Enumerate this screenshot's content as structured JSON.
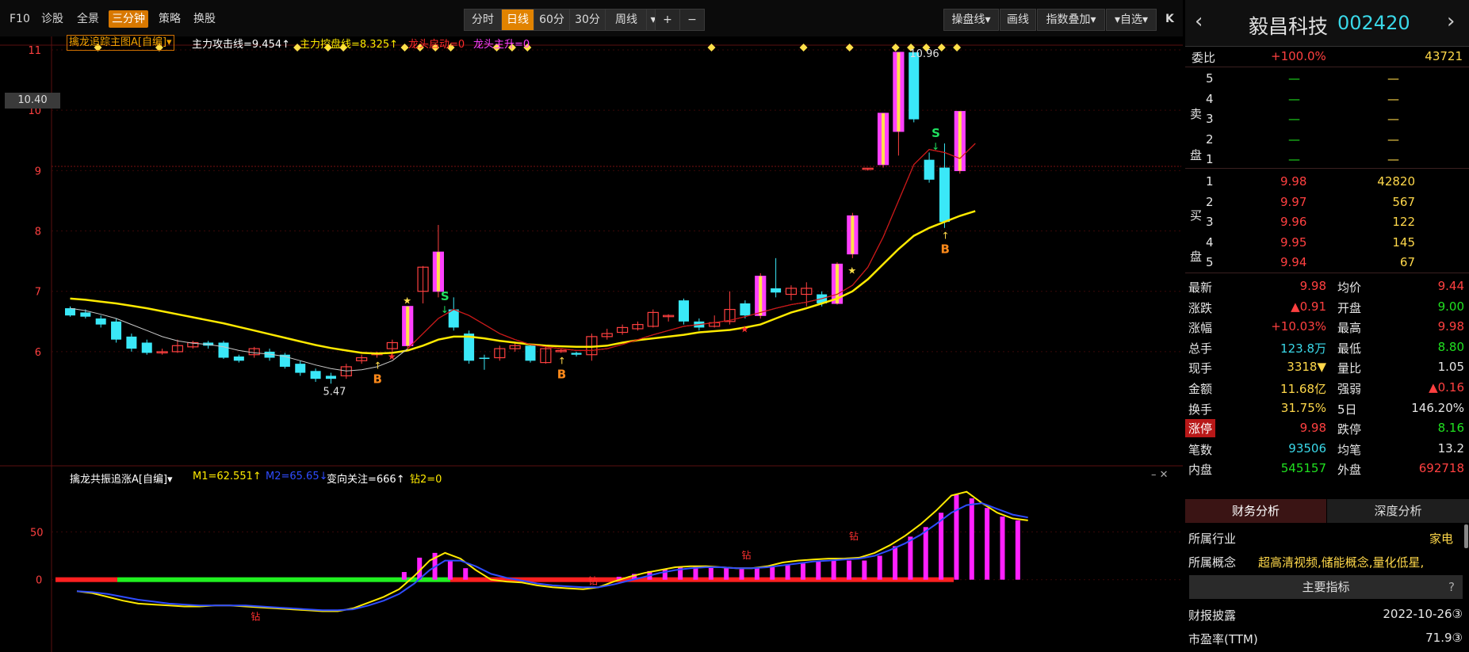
{
  "toolbar": {
    "left_items": [
      "F10",
      "诊股",
      "全景",
      "三分钟",
      "策略",
      "换股"
    ],
    "active_left": "三分钟",
    "periods": [
      "分时",
      "日线",
      "60分",
      "30分",
      "周线"
    ],
    "active_period": "日线",
    "zoom_in": "+",
    "zoom_out": "−",
    "right_buttons": [
      "操盘线",
      "画线",
      "指数叠加",
      "自选"
    ],
    "collapse": "K"
  },
  "main_indicator": {
    "name": "擒龙追踪主图A[自编]",
    "values": [
      {
        "text": "主力攻击线=9.454↑",
        "color": "#ffffff"
      },
      {
        "text": "主力控盘线=8.325↑",
        "color": "#ffea00"
      },
      {
        "text": "龙头启动=0",
        "color": "#ff2a2a"
      },
      {
        "text": "龙头主升=0",
        "color": "#ff40ff"
      }
    ]
  },
  "sub_indicator": {
    "name": "擒龙共振追涨A[自编]",
    "values": [
      {
        "text": "M1=62.551↑",
        "color": "#ffea00"
      },
      {
        "text": "M2=65.65↓",
        "color": "#2f4cff"
      },
      {
        "text": "变向关注=666↑",
        "color": "#ffffff"
      },
      {
        "text": "钻2=0",
        "color": "#ffea00"
      }
    ]
  },
  "current_price_tag": "10.40",
  "chart_data": {
    "type": "candlestick",
    "y_ticks_main": [
      6,
      7,
      8,
      9,
      10,
      11
    ],
    "y_ticks_sub": [
      0,
      50
    ],
    "annotations": {
      "low": "5.47",
      "high": "10.96",
      "buy_label": "B",
      "sell_label": "S",
      "drill_label": "钻"
    },
    "candles": [
      {
        "o": 6.72,
        "c": 6.6,
        "h": 6.75,
        "l": 6.58
      },
      {
        "o": 6.65,
        "c": 6.58,
        "h": 6.7,
        "l": 6.55
      },
      {
        "o": 6.55,
        "c": 6.45,
        "h": 6.6,
        "l": 6.4
      },
      {
        "o": 6.5,
        "c": 6.2,
        "h": 6.55,
        "l": 6.15
      },
      {
        "o": 6.25,
        "c": 6.05,
        "h": 6.3,
        "l": 6.0
      },
      {
        "o": 6.15,
        "c": 5.98,
        "h": 6.2,
        "l": 5.95
      },
      {
        "o": 5.98,
        "c": 6.0,
        "h": 6.05,
        "l": 5.95
      },
      {
        "o": 6.0,
        "c": 6.1,
        "h": 6.2,
        "l": 5.98
      },
      {
        "o": 6.08,
        "c": 6.15,
        "h": 6.18,
        "l": 6.05
      },
      {
        "o": 6.15,
        "c": 6.1,
        "h": 6.18,
        "l": 6.05
      },
      {
        "o": 6.15,
        "c": 5.9,
        "h": 6.18,
        "l": 5.88
      },
      {
        "o": 5.92,
        "c": 5.85,
        "h": 5.95,
        "l": 5.82
      },
      {
        "o": 5.95,
        "c": 6.05,
        "h": 6.08,
        "l": 5.9
      },
      {
        "o": 6.0,
        "c": 5.9,
        "h": 6.05,
        "l": 5.85
      },
      {
        "o": 5.95,
        "c": 5.75,
        "h": 5.98,
        "l": 5.72
      },
      {
        "o": 5.8,
        "c": 5.65,
        "h": 5.85,
        "l": 5.6
      },
      {
        "o": 5.68,
        "c": 5.55,
        "h": 5.72,
        "l": 5.5
      },
      {
        "o": 5.6,
        "c": 5.55,
        "h": 5.65,
        "l": 5.47
      },
      {
        "o": 5.6,
        "c": 5.75,
        "h": 5.8,
        "l": 5.55
      },
      {
        "o": 5.85,
        "c": 5.9,
        "h": 5.95,
        "l": 5.8
      },
      {
        "o": 5.95,
        "c": 5.98,
        "h": 6.0,
        "l": 5.9
      },
      {
        "o": 6.05,
        "c": 6.15,
        "h": 6.2,
        "l": 5.95
      },
      {
        "o": 6.1,
        "c": 6.75,
        "h": 6.75,
        "l": 6.05
      },
      {
        "o": 7.0,
        "c": 7.4,
        "h": 7.42,
        "l": 6.8
      },
      {
        "o": 7.0,
        "c": 7.65,
        "h": 8.1,
        "l": 6.9
      },
      {
        "o": 6.7,
        "c": 6.4,
        "h": 6.9,
        "l": 6.35
      },
      {
        "o": 6.3,
        "c": 5.85,
        "h": 6.35,
        "l": 5.8
      },
      {
        "o": 5.9,
        "c": 5.88,
        "h": 5.95,
        "l": 5.7
      },
      {
        "o": 5.9,
        "c": 6.05,
        "h": 6.1,
        "l": 5.85
      },
      {
        "o": 6.05,
        "c": 6.1,
        "h": 6.15,
        "l": 6.0
      },
      {
        "o": 6.1,
        "c": 5.85,
        "h": 6.12,
        "l": 5.82
      },
      {
        "o": 5.82,
        "c": 6.05,
        "h": 6.08,
        "l": 5.8
      },
      {
        "o": 6.0,
        "c": 6.02,
        "h": 6.05,
        "l": 5.98
      },
      {
        "o": 5.98,
        "c": 5.95,
        "h": 6.0,
        "l": 5.92
      },
      {
        "o": 5.95,
        "c": 6.25,
        "h": 6.3,
        "l": 5.85
      },
      {
        "o": 6.25,
        "c": 6.3,
        "h": 6.38,
        "l": 6.2
      },
      {
        "o": 6.32,
        "c": 6.4,
        "h": 6.45,
        "l": 6.28
      },
      {
        "o": 6.38,
        "c": 6.45,
        "h": 6.5,
        "l": 6.35
      },
      {
        "o": 6.42,
        "c": 6.65,
        "h": 6.7,
        "l": 6.4
      },
      {
        "o": 6.58,
        "c": 6.6,
        "h": 6.62,
        "l": 6.5
      },
      {
        "o": 6.85,
        "c": 6.5,
        "h": 6.88,
        "l": 6.45
      },
      {
        "o": 6.5,
        "c": 6.4,
        "h": 6.55,
        "l": 6.35
      },
      {
        "o": 6.42,
        "c": 6.48,
        "h": 6.6,
        "l": 6.4
      },
      {
        "o": 6.5,
        "c": 6.7,
        "h": 7.0,
        "l": 6.45
      },
      {
        "o": 6.8,
        "c": 6.6,
        "h": 6.85,
        "l": 6.55
      },
      {
        "o": 6.6,
        "c": 7.25,
        "h": 7.3,
        "l": 6.55
      },
      {
        "o": 7.05,
        "c": 6.98,
        "h": 7.55,
        "l": 6.9
      },
      {
        "o": 6.95,
        "c": 7.05,
        "h": 7.1,
        "l": 6.85
      },
      {
        "o": 6.95,
        "c": 7.05,
        "h": 7.15,
        "l": 6.75
      },
      {
        "o": 6.95,
        "c": 6.8,
        "h": 7.0,
        "l": 6.75
      },
      {
        "o": 6.8,
        "c": 7.45,
        "h": 7.48,
        "l": 6.78
      },
      {
        "o": 7.62,
        "c": 8.25,
        "h": 8.3,
        "l": 7.55
      },
      {
        "o": 9.02,
        "c": 9.04,
        "h": 9.04,
        "l": 9.0
      },
      {
        "o": 9.1,
        "c": 9.95,
        "h": 9.95,
        "l": 9.05
      },
      {
        "o": 9.65,
        "c": 10.96,
        "h": 10.96,
        "l": 9.25
      },
      {
        "o": 10.96,
        "c": 9.85,
        "h": 10.96,
        "l": 9.8
      },
      {
        "o": 9.18,
        "c": 8.85,
        "h": 9.3,
        "l": 8.8
      },
      {
        "o": 9.05,
        "c": 8.15,
        "h": 9.45,
        "l": 8.05
      },
      {
        "o": 9.0,
        "c": 9.98,
        "h": 9.98,
        "l": 8.95
      }
    ],
    "sub_bars": [
      0,
      0,
      0,
      0,
      0,
      0,
      0,
      0,
      0,
      0,
      0,
      0,
      0,
      0,
      0,
      0,
      0,
      0,
      0,
      0,
      0,
      8,
      23,
      28,
      20,
      12,
      0,
      0,
      0,
      0,
      0,
      0,
      0,
      0,
      0,
      3,
      6,
      9,
      11,
      13,
      14,
      13,
      12,
      11,
      12,
      13,
      16,
      17,
      19,
      20,
      20,
      20,
      25,
      35,
      45,
      55,
      70,
      89,
      85,
      75,
      66,
      62
    ],
    "sub_m1": [
      -12,
      -14,
      -18,
      -22,
      -25,
      -26,
      -27,
      -28,
      -28,
      -27,
      -27,
      -28,
      -29,
      -30,
      -31,
      -32,
      -33,
      -33,
      -30,
      -24,
      -18,
      -10,
      4,
      20,
      28,
      22,
      10,
      0,
      -2,
      -3,
      -6,
      -8,
      -9,
      -10,
      -8,
      -2,
      3,
      7,
      10,
      13,
      14,
      14,
      13,
      12,
      12,
      14,
      18,
      20,
      21,
      22,
      22,
      23,
      28,
      36,
      46,
      58,
      72,
      88,
      92,
      80,
      70,
      64,
      62
    ],
    "sub_m2": [
      -12,
      -13,
      -15,
      -18,
      -21,
      -23,
      -25,
      -26,
      -27,
      -27,
      -27,
      -27,
      -28,
      -29,
      -30,
      -31,
      -32,
      -32,
      -31,
      -27,
      -22,
      -15,
      -4,
      10,
      20,
      20,
      14,
      6,
      2,
      -1,
      -4,
      -6,
      -7,
      -8,
      -8,
      -5,
      -1,
      3,
      7,
      10,
      12,
      13,
      13,
      12,
      12,
      13,
      15,
      17,
      19,
      20,
      21,
      22,
      25,
      31,
      38,
      47,
      58,
      70,
      78,
      80,
      74,
      68,
      65
    ],
    "attack_line": [
      6.72,
      6.68,
      6.62,
      6.55,
      6.45,
      6.35,
      6.25,
      6.18,
      6.14,
      6.12,
      6.08,
      6.02,
      5.98,
      5.96,
      5.92,
      5.85,
      5.78,
      5.72,
      5.68,
      5.7,
      5.75,
      5.85,
      6.05,
      6.3,
      6.55,
      6.7,
      6.6,
      6.45,
      6.3,
      6.2,
      6.12,
      6.08,
      6.05,
      6.02,
      6.02,
      6.05,
      6.12,
      6.2,
      6.28,
      6.35,
      6.42,
      6.45,
      6.48,
      6.52,
      6.58,
      6.65,
      6.72,
      6.78,
      6.82,
      6.88,
      6.95,
      7.1,
      7.4,
      7.9,
      8.5,
      9.1,
      9.35,
      9.3,
      9.2,
      9.45
    ],
    "control_line": [
      6.88,
      6.86,
      6.83,
      6.8,
      6.76,
      6.72,
      6.67,
      6.62,
      6.57,
      6.52,
      6.47,
      6.41,
      6.35,
      6.29,
      6.23,
      6.17,
      6.11,
      6.06,
      6.02,
      5.98,
      5.97,
      5.98,
      6.02,
      6.1,
      6.2,
      6.25,
      6.25,
      6.22,
      6.18,
      6.15,
      6.12,
      6.1,
      6.09,
      6.08,
      6.08,
      6.1,
      6.15,
      6.19,
      6.22,
      6.25,
      6.28,
      6.32,
      6.34,
      6.36,
      6.4,
      6.45,
      6.55,
      6.65,
      6.72,
      6.8,
      6.88,
      7.0,
      7.2,
      7.45,
      7.7,
      7.92,
      8.05,
      8.15,
      8.25,
      8.33
    ]
  },
  "quote": {
    "name": "毅昌科技",
    "code": "002420",
    "weibi_label": "委比",
    "weibi": "+100.0%",
    "weicha": "43721",
    "sell_side_label": "卖盘",
    "buy_side_label": "买盘",
    "sells": [
      {
        "lvl": "5",
        "price": "—",
        "vol": "—"
      },
      {
        "lvl": "4",
        "price": "—",
        "vol": "—"
      },
      {
        "lvl": "3",
        "price": "—",
        "vol": "—"
      },
      {
        "lvl": "2",
        "price": "—",
        "vol": "—"
      },
      {
        "lvl": "1",
        "price": "—",
        "vol": "—"
      }
    ],
    "buys": [
      {
        "lvl": "1",
        "price": "9.98",
        "vol": "42820"
      },
      {
        "lvl": "2",
        "price": "9.97",
        "vol": "567"
      },
      {
        "lvl": "3",
        "price": "9.96",
        "vol": "122"
      },
      {
        "lvl": "4",
        "price": "9.95",
        "vol": "145"
      },
      {
        "lvl": "5",
        "price": "9.94",
        "vol": "67"
      }
    ],
    "stats": [
      {
        "l1": "最新",
        "v1": "9.98",
        "c1": "r",
        "l2": "均价",
        "v2": "9.44",
        "c2": "r"
      },
      {
        "l1": "涨跌",
        "v1": "▲0.91",
        "c1": "r",
        "l2": "开盘",
        "v2": "9.00",
        "c2": "g"
      },
      {
        "l1": "涨幅",
        "v1": "+10.03%",
        "c1": "r",
        "l2": "最高",
        "v2": "9.98",
        "c2": "r"
      },
      {
        "l1": "总手",
        "v1": "123.8万",
        "c1": "c",
        "l2": "最低",
        "v2": "8.80",
        "c2": "g"
      },
      {
        "l1": "现手",
        "v1": "3318▼",
        "c1": "y",
        "l2": "量比",
        "v2": "1.05",
        "c2": "w"
      },
      {
        "l1": "金额",
        "v1": "11.68亿",
        "c1": "y",
        "l2": "强弱",
        "v2": "▲0.16",
        "c2": "r"
      },
      {
        "l1": "换手",
        "v1": "31.75%",
        "c1": "y",
        "l2": "5日",
        "v2": "146.20%",
        "c2": "w"
      },
      {
        "l1": "涨停",
        "v1": "9.98",
        "c1": "r",
        "l2": "跌停",
        "v2": "8.16",
        "c2": "g"
      },
      {
        "l1": "笔数",
        "v1": "93506",
        "c1": "c",
        "l2": "均笔",
        "v2": "13.2",
        "c2": "w"
      },
      {
        "l1": "内盘",
        "v1": "545157",
        "c1": "g",
        "l2": "外盘",
        "v2": "692718",
        "c2": "r"
      }
    ],
    "tabs": [
      "财务分析",
      "深度分析"
    ],
    "industry_label": "所属行业",
    "industry": "家电",
    "concept_label": "所属概念",
    "concept": "超高清视频,储能概念,量化低星,",
    "main_indicators": "主要指标",
    "help": "?",
    "report_label": "财报披露",
    "report_date": "2022-10-26③",
    "pe_label": "市盈率(TTM)",
    "pe": "71.9③"
  }
}
